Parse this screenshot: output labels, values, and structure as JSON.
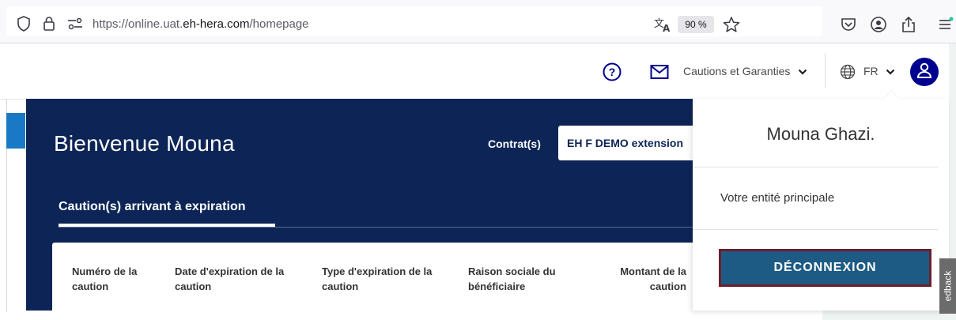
{
  "browser": {
    "url_prefix": "https://online.uat.",
    "url_domain": "eh-hera.com",
    "url_path": "/homepage",
    "zoom": "90 %"
  },
  "header": {
    "products_label": "Cautions et Garanties",
    "language": "FR"
  },
  "hero": {
    "welcome": "Bienvenue Mouna",
    "contract_label": "Contrat(s)",
    "contract_value": "EH F DEMO extension",
    "tab_label": "Caution(s) arrivant à expiration"
  },
  "table": {
    "columns": [
      "Numéro de la\ncaution",
      "Date d'expiration de la\ncaution",
      "Type d'expiration de la\ncaution",
      "Raison sociale du\nbénéficiaire",
      "Montant de la\ncaution"
    ]
  },
  "dropdown": {
    "user_name": "Mouna Ghazi.",
    "entity_label": "Votre entité principale",
    "logout_label": "DÉCONNEXION"
  },
  "feedback": {
    "label": "edback"
  },
  "colors": {
    "navy": "#0d2556",
    "axa_blue": "#00008f",
    "logout_bg": "#1e5b84",
    "logout_border": "#6b1f2c",
    "accent_blue": "#1a79c6"
  }
}
